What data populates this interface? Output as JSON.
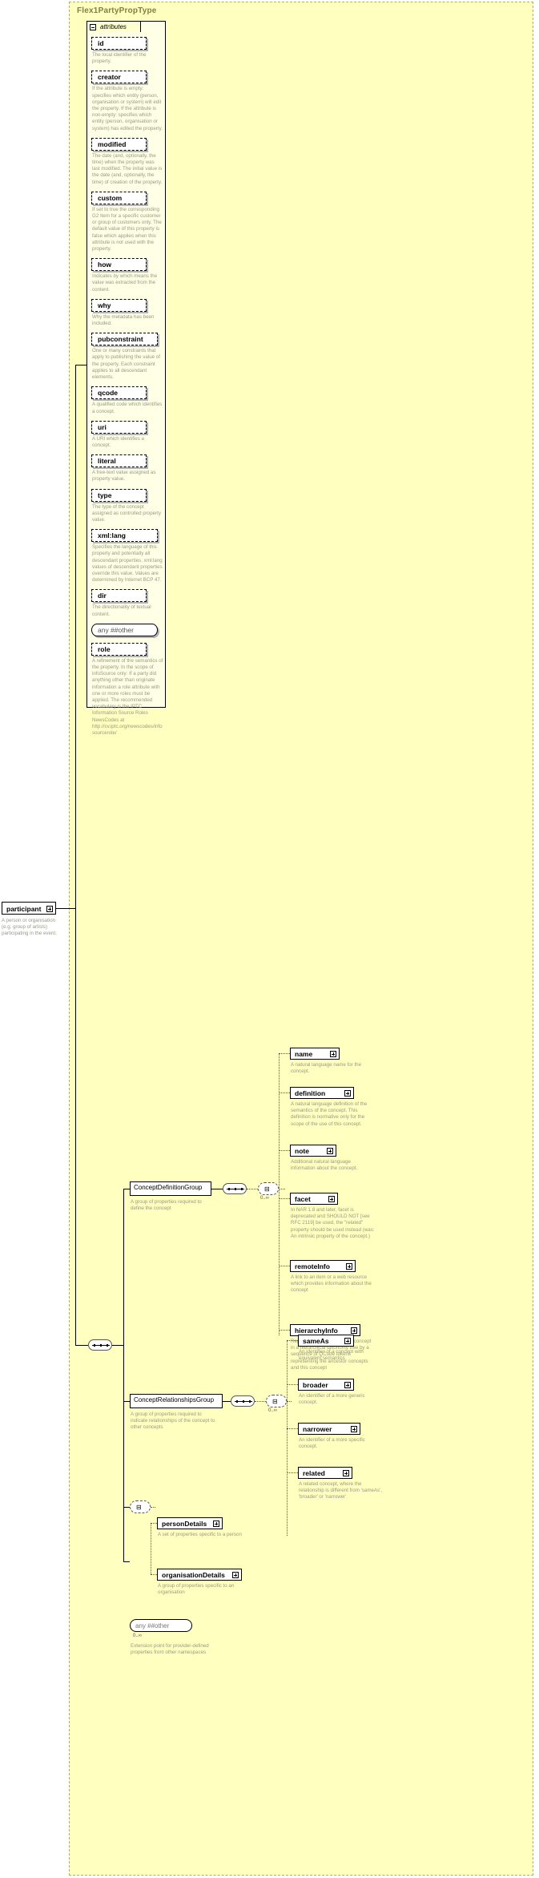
{
  "diagram": {
    "type_name": "Flex1PartyPropType",
    "attributes_panel_label": "attributes"
  },
  "attributes": [
    {
      "name": "id",
      "desc": "The local identifier of the property."
    },
    {
      "name": "creator",
      "desc": "If the attribute is empty: specifies which entity (person, organisation or system) will edit the property. If the attribute is non-empty: specifies which entity (person, organisation or system) has edited the property."
    },
    {
      "name": "modified",
      "desc": "The date (and, optionally, the time) when the property was last modified. The initial value is the date (and, optionally, the time) of creation of the property."
    },
    {
      "name": "custom",
      "desc": "If set to true the corresponding G2 Item for a specific customer or group of customers only. The default value of this property is false which applies when this attribute is not used with the property."
    },
    {
      "name": "how",
      "desc": "Indicates by which means the value was extracted from the content."
    },
    {
      "name": "why",
      "desc": "Why the metadata has been included."
    },
    {
      "name": "pubconstraint",
      "desc": "One or many constraints that apply to publishing the value of the property. Each constraint applies to all descendant elements."
    },
    {
      "name": "qcode",
      "desc": "A qualified code which identifies a concept."
    },
    {
      "name": "uri",
      "desc": "A URI which identifies a concept."
    },
    {
      "name": "literal",
      "desc": "A free-text value assigned as property value."
    },
    {
      "name": "type",
      "desc": "The type of the concept assigned as controlled property value."
    },
    {
      "name": "xml:lang",
      "desc": "Specifies the language of this property and potentially all descendant properties. xml:lang values of descendant properties override this value. Values are determined by Internet BCP 47."
    },
    {
      "name": "dir",
      "desc": "The directionality of textual content."
    },
    {
      "name": "any ##other",
      "desc": "",
      "is_any": true
    },
    {
      "name": "role",
      "desc": "A refinement of the semantics of the property. In the scope of infoSource only: If a party did anything other than originate information a role attribute with one or more roles must be applied. The recommended vocabulary is the IPTC Information Source Roles NewsCodes at http://cv.iptc.org/newscodes/infosourcerole/"
    }
  ],
  "root_element": {
    "name": "participant",
    "desc": "A person or organisation (e.g. group of artists) participating in the event."
  },
  "groups": [
    {
      "name": "ConceptDefinitionGroup",
      "desc": "A group of properties required to define the concept",
      "occurrence": "0..∞",
      "elements": [
        {
          "name": "name",
          "desc": "A natural language name for the concept."
        },
        {
          "name": "definition",
          "desc": "A natural language definition of the semantics of the concept. This definition is normative only for the scope of the use of this concept."
        },
        {
          "name": "note",
          "desc": "Additional natural language information about the concept."
        },
        {
          "name": "facet",
          "desc": "In NAR 1.8 and later, facet is deprecated and SHOULD NOT [see RFC 2119] be used, the \"related\" property should be used instead (was: An intrinsic property of the concept.)"
        },
        {
          "name": "remoteInfo",
          "desc": "A link to an item or a web resource which provides information about the concept"
        },
        {
          "name": "hierarchyInfo",
          "desc": "Represents the position of a concept in a hierarchical taxonomy tree by a sequence of QCode tokens representing the ancestor concepts and this concept"
        }
      ]
    },
    {
      "name": "ConceptRelationshipsGroup",
      "desc": "A group of properties required to indicate relationships of the concept to other concepts",
      "occurrence": "0..∞",
      "elements": [
        {
          "name": "sameAs",
          "desc": "An identifier of a concept with equivalent semantics"
        },
        {
          "name": "broader",
          "desc": "An identifier of a more generic concept."
        },
        {
          "name": "narrower",
          "desc": "An identifier of a more specific concept."
        },
        {
          "name": "related",
          "desc": "A related concept, where the relationship is different from 'sameAs', 'broader' or 'narrower'."
        }
      ]
    }
  ],
  "details_choice": {
    "elements": [
      {
        "name": "personDetails",
        "desc": "A set of properties specific to a person"
      },
      {
        "name": "organisationDetails",
        "desc": "A group of properties specific to an organisation"
      }
    ]
  },
  "extension": {
    "name": "any ##other",
    "occurrence": "0..∞",
    "desc": "Extension point for provider-defined properties from other namespaces"
  }
}
